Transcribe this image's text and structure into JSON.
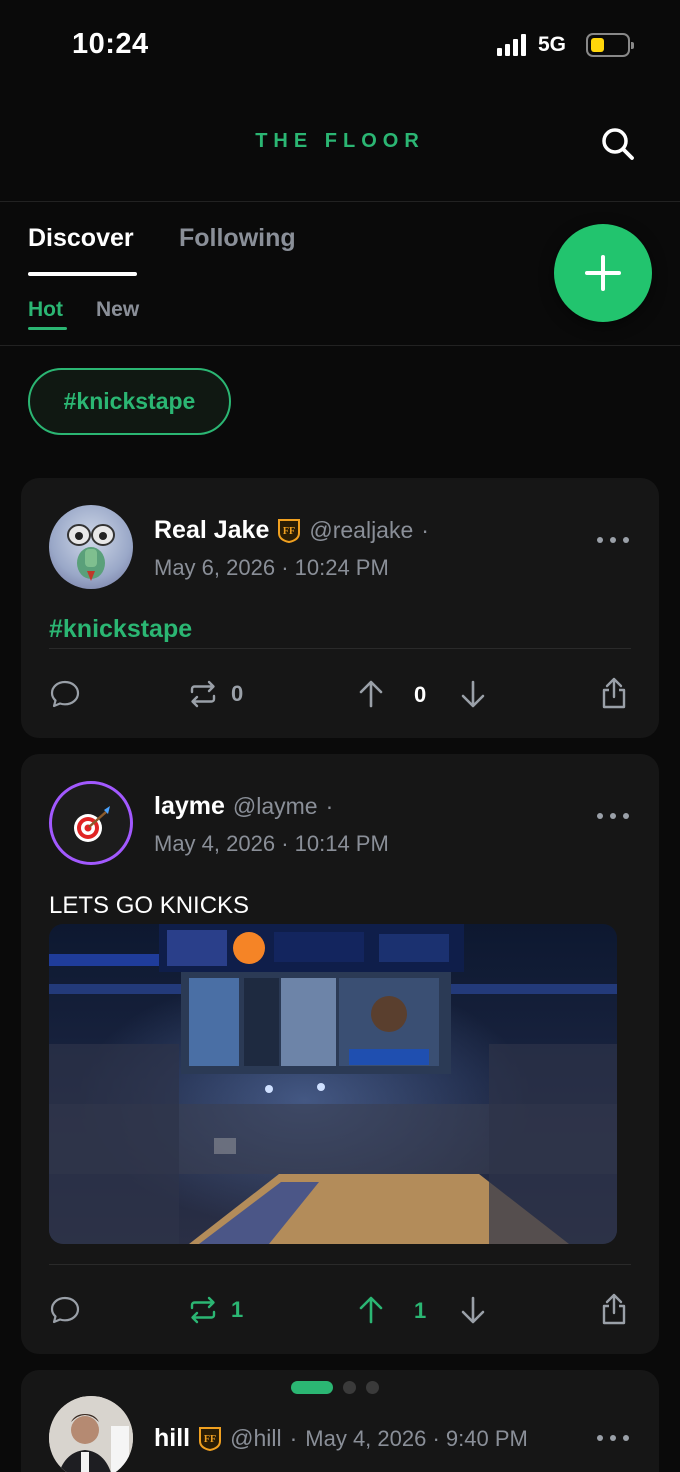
{
  "status_bar": {
    "time": "10:24",
    "network": "5G",
    "battery_color": "#ffd60a"
  },
  "header": {
    "brand": "THE FLOOR",
    "search_icon": "search-icon"
  },
  "tabs": {
    "primary": [
      "Discover",
      "Following"
    ],
    "active_primary": "Discover",
    "secondary": [
      "Hot",
      "New"
    ],
    "active_secondary": "Hot"
  },
  "fab": {
    "icon": "plus-icon"
  },
  "filter_chip": "#knickstape",
  "accent_color": "#2bb673",
  "posts": [
    {
      "display_name": "Real Jake",
      "badge": "FF",
      "handle": "@realjake",
      "date": "May 6, 2026 · 10:24 PM",
      "hashtag": "#knickstape",
      "reposts": "0",
      "score": "0"
    },
    {
      "display_name": "layme",
      "handle": "@layme",
      "date": "May 4, 2026 · 10:14 PM",
      "text": "LETS GO KNICKS",
      "image": "arena-photo",
      "reposts": "1",
      "score": "1"
    },
    {
      "display_name": "hill",
      "badge": "FF",
      "handle": "@hill",
      "date": "May 4, 2026 · 9:40 PM"
    }
  ],
  "sep": "·"
}
